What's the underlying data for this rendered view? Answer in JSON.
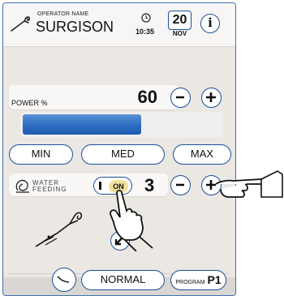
{
  "header": {
    "operator_label": "OPERATOR NAME",
    "operator_name": "SURGISON",
    "time": "10:35",
    "day": "20",
    "month": "NOV",
    "info_symbol": "i"
  },
  "power": {
    "label": "POWER %",
    "value": "60",
    "level_percent": 60,
    "minus": "−",
    "plus": "+"
  },
  "presets": [
    "MIN",
    "MED",
    "MAX"
  ],
  "water": {
    "label_line1": "WATER",
    "label_line2": "FEEDING",
    "toggle_text": "ON",
    "value": "3",
    "minus": "−",
    "plus": "+"
  },
  "footer": {
    "mode": "NORMAL",
    "program_label": "PROGRAM",
    "program_value": "P1"
  },
  "colors": {
    "border_blue": "#1a4e95",
    "bar_blue": "#2f6fc4",
    "panel_bg": "#ebe7e3",
    "toggle_on": "#f4e0a0"
  },
  "icons": [
    "dental-handpiece-icon",
    "clock-icon",
    "info-icon",
    "water-drop-icon",
    "pointing-hand-icon",
    "arrow-diagonal-icon",
    "curve-icon"
  ]
}
